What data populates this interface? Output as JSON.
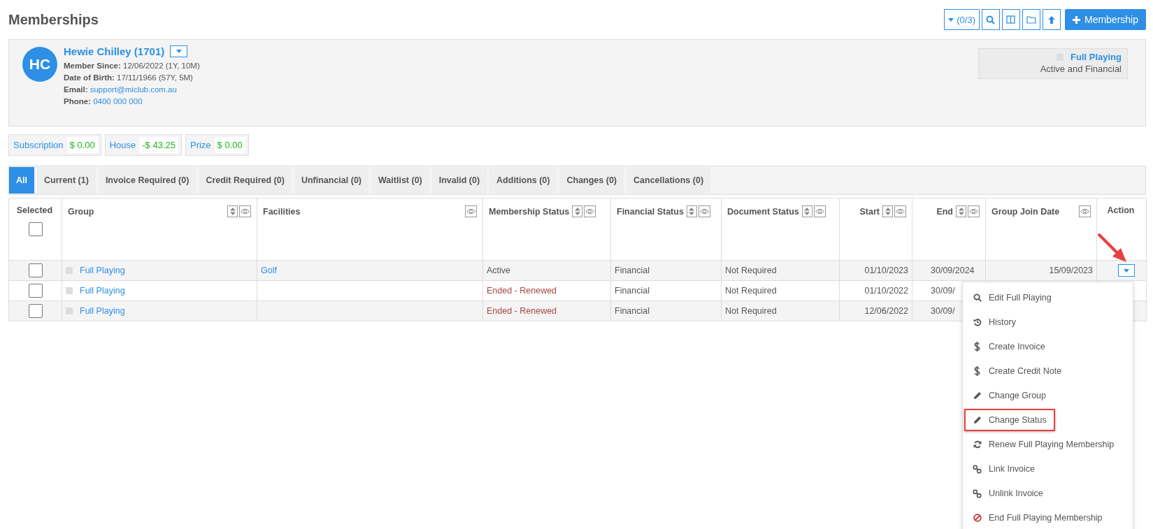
{
  "page_title": "Memberships",
  "toolbar": {
    "filter_count": "(0/3)",
    "add_button": "Membership"
  },
  "member": {
    "initials": "HC",
    "name": "Hewie Chilley (1701)",
    "fields": [
      {
        "label": "Member Since:",
        "value": "12/06/2022 (1Y, 10M)",
        "kind": "text"
      },
      {
        "label": "Date of Birth:",
        "value": "17/11/1966 (57Y, 5M)",
        "kind": "text"
      },
      {
        "label": "Email:",
        "value": "support@miclub.com.au",
        "kind": "link"
      },
      {
        "label": "Phone:",
        "value": "0400 000 000",
        "kind": "link"
      }
    ],
    "membership": {
      "group": "Full Playing",
      "color": "#dddddd",
      "status": "Active and Financial"
    }
  },
  "balances": [
    {
      "label": "Subscription",
      "amount": "$ 0.00"
    },
    {
      "label": "House",
      "amount": "-$ 43.25"
    },
    {
      "label": "Prize",
      "amount": "$ 0.00"
    }
  ],
  "tabs": [
    {
      "label": "All",
      "selected": true
    },
    {
      "label": "Current (1)",
      "selected": false
    },
    {
      "label": "Invoice Required (0)",
      "selected": false
    },
    {
      "label": "Credit Required (0)",
      "selected": false
    },
    {
      "label": "Unfinancial (0)",
      "selected": false
    },
    {
      "label": "Waitlist (0)",
      "selected": false
    },
    {
      "label": "Invalid (0)",
      "selected": false
    },
    {
      "label": "Additions (0)",
      "selected": false
    },
    {
      "label": "Changes (0)",
      "selected": false
    },
    {
      "label": "Cancellations (0)",
      "selected": false
    }
  ],
  "table": {
    "columns": [
      {
        "label": "Selected",
        "sortable": false,
        "hideable": false
      },
      {
        "label": "Group",
        "sortable": true,
        "hideable": true
      },
      {
        "label": "Facilities",
        "sortable": false,
        "hideable": true
      },
      {
        "label": "Membership Status",
        "sortable": true,
        "hideable": true
      },
      {
        "label": "Financial Status",
        "sortable": true,
        "hideable": true
      },
      {
        "label": "Document Status",
        "sortable": true,
        "hideable": true
      },
      {
        "label": "Start",
        "sortable": true,
        "hideable": true
      },
      {
        "label": "End",
        "sortable": true,
        "hideable": true
      },
      {
        "label": "Group Join Date",
        "sortable": false,
        "hideable": true
      },
      {
        "label": "Action",
        "sortable": false,
        "hideable": false
      }
    ],
    "select_all_checked": false,
    "rows": [
      {
        "checked": false,
        "group": "Full Playing",
        "color": "#dddddd",
        "facilities": "Golf",
        "membership_status": "Active",
        "ended": false,
        "menu_open": true,
        "financial_status": "Financial",
        "document_status": "Not Required",
        "start": "01/10/2023",
        "end": "30/09/2024",
        "group_join_date": "15/09/2023",
        "action_visible": true
      },
      {
        "checked": false,
        "group": "Full Playing",
        "color": "#dddddd",
        "membership_status": "Ended - Renewed",
        "ended": true,
        "menu_open": false,
        "financial_status": "Financial",
        "document_status": "Not Required",
        "start": "01/10/2022",
        "end": "30/09/",
        "action_visible": false
      },
      {
        "checked": false,
        "group": "Full Playing",
        "color": "#dddddd",
        "membership_status": "Ended - Renewed",
        "ended": true,
        "menu_open": false,
        "financial_status": "Financial",
        "document_status": "Not Required",
        "start": "12/06/2022",
        "end": "30/09/",
        "action_visible": false
      }
    ]
  },
  "action_menu": {
    "items": [
      {
        "label": "Edit Full Playing",
        "kind": "edit",
        "highlighted": false
      },
      {
        "label": "History",
        "kind": "history",
        "highlighted": false
      },
      {
        "label": "Create Invoice",
        "kind": "money",
        "highlighted": false
      },
      {
        "label": "Create Credit Note",
        "kind": "money",
        "highlighted": false
      },
      {
        "label": "Change Group",
        "kind": "modify",
        "highlighted": false
      },
      {
        "label": "Change Status",
        "kind": "modify",
        "highlighted": true
      },
      {
        "label": "Renew Full Playing Membership",
        "kind": "renew",
        "highlighted": false
      },
      {
        "label": "Link Invoice",
        "kind": "link",
        "highlighted": false
      },
      {
        "label": "Unlink Invoice",
        "kind": "link",
        "highlighted": false
      },
      {
        "label": "End Full Playing Membership",
        "kind": "end",
        "highlighted": false
      }
    ]
  }
}
